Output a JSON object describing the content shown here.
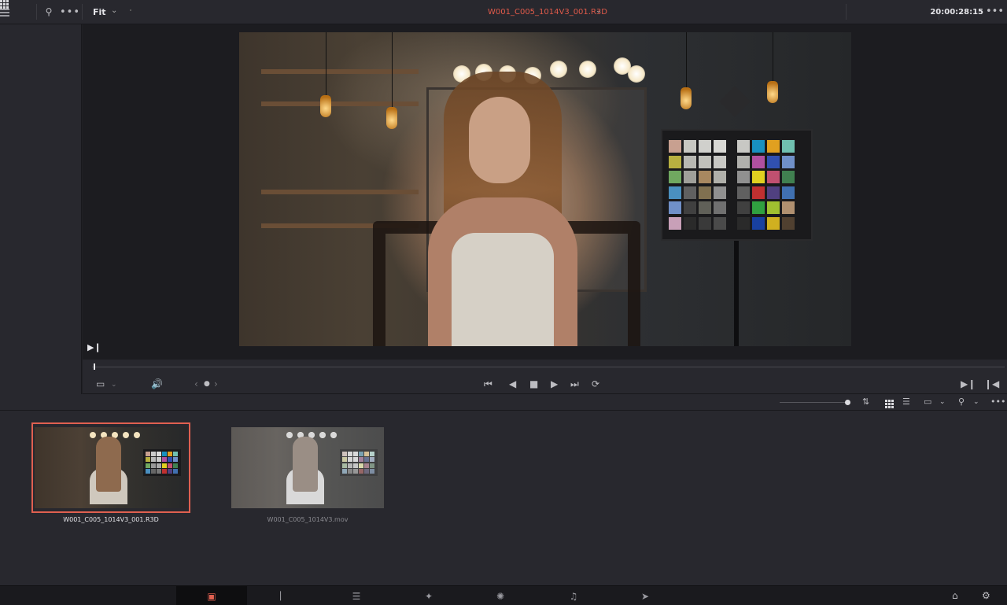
{
  "topbar": {
    "fit_label": "Fit",
    "clip_title": "W001_C005_1014V3_001.R3D",
    "timecode": "20:00:28:15",
    "icons": [
      "grid-view-icon",
      "list-view-icon",
      "search-icon",
      "more-options-icon",
      "chevron-down-icon"
    ]
  },
  "viewer": {
    "accent_color": "#e05a4a"
  },
  "media_pool": {
    "clips": [
      {
        "name": "W001_C005_1014V3_001.R3D",
        "selected": true
      },
      {
        "name": "W001_C005_1014V3.mov",
        "selected": false
      }
    ]
  },
  "pagebar": {
    "pages": [
      "Media",
      "Cut",
      "Edit",
      "Fusion",
      "Color",
      "Fairlight",
      "Deliver"
    ],
    "active_page": "Media"
  }
}
